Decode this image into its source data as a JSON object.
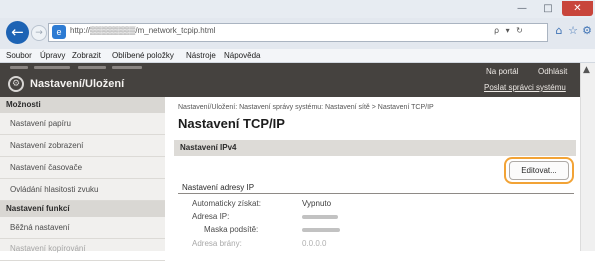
{
  "window": {
    "minimize_symbol": "—",
    "maximize_symbol": "□",
    "close_symbol": "✕"
  },
  "addressbar": {
    "url": "http://▒▒▒▒▒▒▒▒/m_network_tcpip.html",
    "tools": "ρ ▾ ↻",
    "back_symbol": "←",
    "forward_symbol": "→",
    "page_icon": "e"
  },
  "toolbar": {
    "home_symbol": "⌂",
    "favorites_symbol": "☆",
    "settings_symbol": "⚙"
  },
  "menubar": {
    "items": [
      "Soubor",
      "Úpravy",
      "Zobrazit",
      "Oblíbené položky",
      "Nástroje",
      "Nápověda"
    ]
  },
  "header": {
    "title": "Nastavení/Uložení",
    "logout": "Odhlásit",
    "role": "Na portál",
    "admin_link": "Poslat správci systému",
    "gear_symbol": "⚙"
  },
  "sidebar": {
    "sections": [
      {
        "heading": "Možnosti",
        "items": [
          "Nastavení papíru",
          "Nastavení zobrazení",
          "Nastavení časovače",
          "Ovládání hlasitosti zvuku"
        ]
      },
      {
        "heading": "Nastavení funkcí",
        "items": [
          "Běžná nastavení",
          "Nastavení kopírování"
        ]
      }
    ]
  },
  "main": {
    "breadcrumb": "Nastavení/Uložení: Nastavení správy systému: Nastavení sítě > Nastavení TCP/IP",
    "title": "Nastavení TCP/IP",
    "section": "Nastavení IPv4",
    "edit_button": "Editovat...",
    "subsection": "Nastavení adresy IP",
    "fields": [
      {
        "label": "Automaticky získat:",
        "value": "Vypnuto"
      },
      {
        "label": "Adresa IP:",
        "value": ""
      },
      {
        "label": "Maska podsítě:",
        "value": ""
      },
      {
        "label": "Adresa brány:",
        "value": "0.0.0.0"
      }
    ]
  },
  "scrollbar": {
    "up_symbol": "▲"
  }
}
